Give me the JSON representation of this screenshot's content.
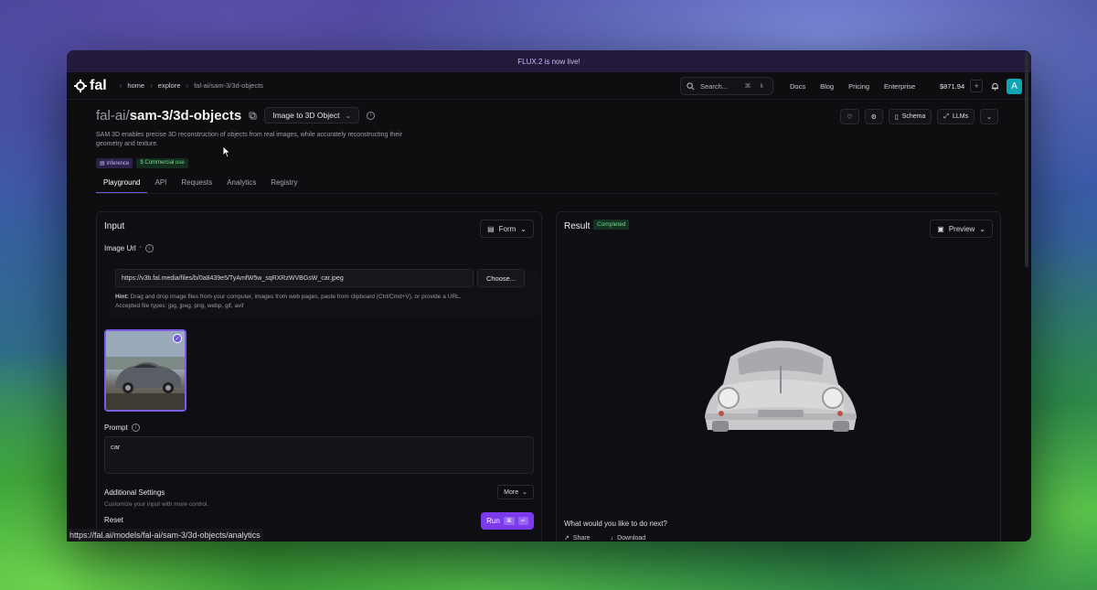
{
  "announcement": "FLUX.2 is now live!",
  "breadcrumb": [
    "home",
    "explore",
    "fal-ai/sam-3/3d-objects"
  ],
  "logo_text": "fal",
  "search": {
    "placeholder": "Search...",
    "shortcut": "⌘ k"
  },
  "nav": [
    "Docs",
    "Blog",
    "Pricing",
    "Enterprise"
  ],
  "credits": "$871.94",
  "avatar_initial": "A",
  "model": {
    "owner": "fal-ai/",
    "name": "sam-3/3d-objects",
    "mode": "Image to 3D Object",
    "description": "SAM 3D enables precise 3D reconstruction of objects from real images, while accurately reconstructing their geometry and texture.",
    "tags": [
      "Inference",
      "Commercial use"
    ]
  },
  "header_buttons": {
    "schema": "Schema",
    "llms": "LLMs"
  },
  "tabs": [
    "Playground",
    "API",
    "Requests",
    "Analytics",
    "Registry"
  ],
  "input": {
    "title": "Input",
    "form_label": "Form",
    "image_url_label": "Image Url",
    "image_url_value": "https://v3b.fal.media/files/b/0a8439e5/TyAmfW5w_sqRXRzWVBGsW_car.jpeg",
    "choose_label": "Choose...",
    "hint_label": "Hint:",
    "hint_text": "Drag and drop image files from your computer, images from web pages, paste from clipboard (Ctrl/Cmd+V), or provide a URL.",
    "accepted_types": "Accepted file types: jpg, jpeg, png, webp, gif, avif",
    "prompt_label": "Prompt",
    "prompt_value": "car",
    "additional_settings": "Additional Settings",
    "additional_settings_sub": "Customize your input with more control.",
    "more_label": "More",
    "reset_label": "Reset",
    "run_label": "Run",
    "run_keys": [
      "⌘",
      "↵"
    ]
  },
  "result": {
    "title": "Result",
    "status": "Completed",
    "preview_label": "Preview",
    "next_prompt": "What would you like to do next?",
    "share_label": "Share",
    "download_label": "Download"
  },
  "status_bar_url": "https://fal.ai/models/fal-ai/sam-3/3d-objects/analytics",
  "colors": {
    "accent": "#7c3aed",
    "completed": "#6fd68a",
    "avatar": "#0ea5b5"
  }
}
